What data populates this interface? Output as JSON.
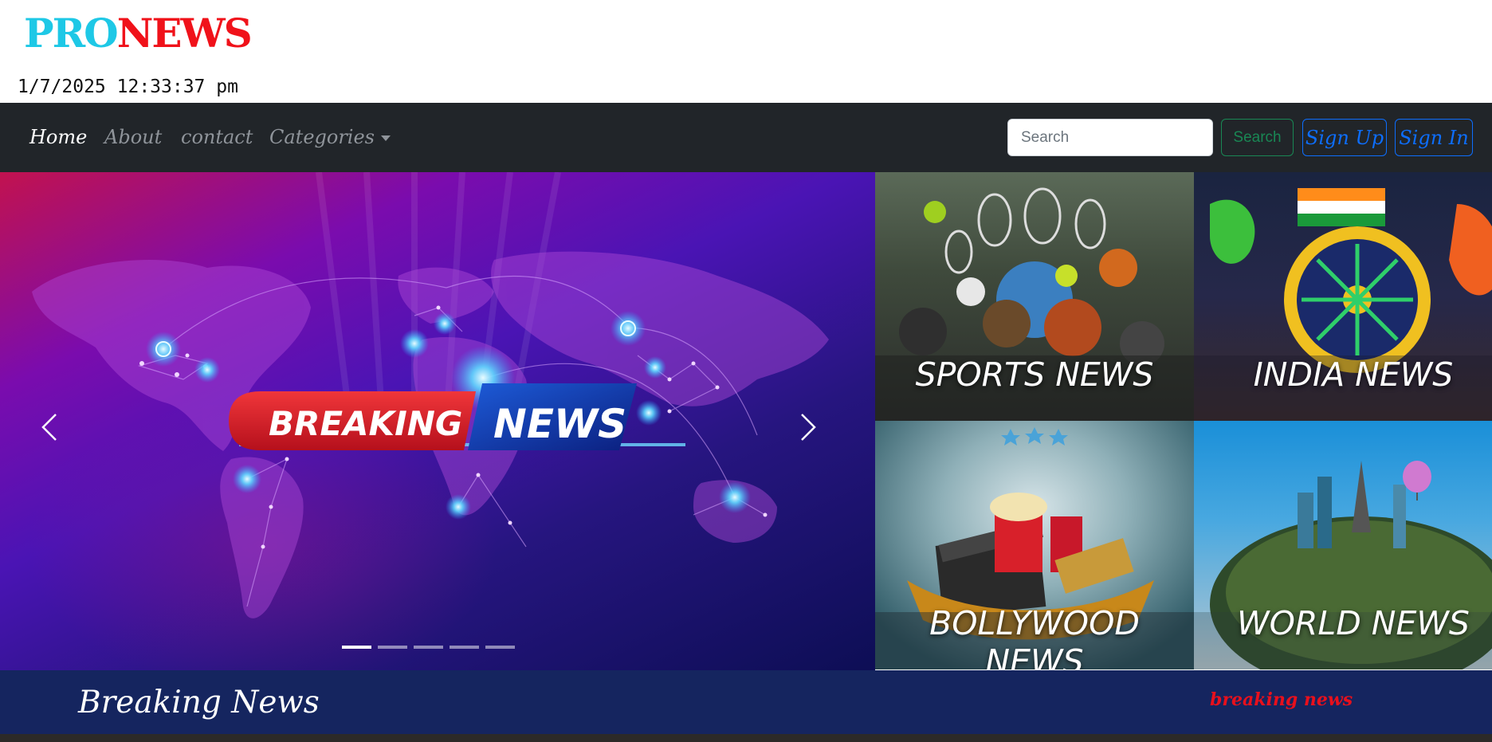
{
  "header": {
    "logo_part1": "PRO",
    "logo_part2": "NEWS",
    "datetime": "1/7/2025 12:33:37 pm"
  },
  "navbar": {
    "links": [
      {
        "label": "Home",
        "active": true
      },
      {
        "label": "About",
        "active": false
      },
      {
        "label": "contact",
        "active": false
      },
      {
        "label": "Categories",
        "active": false
      }
    ],
    "search_placeholder": "Search",
    "search_button": "Search",
    "signup_button": "Sign Up",
    "signin_button": "Sign In"
  },
  "carousel": {
    "banner_left": "BREAKING",
    "banner_right": "NEWS",
    "slide_count": 5,
    "active_slide": 1
  },
  "categories": [
    {
      "label": "SPORTS NEWS"
    },
    {
      "label": "INDIA NEWS"
    },
    {
      "label": "BOLLYWOOD NEWS"
    },
    {
      "label": "WORLD NEWS"
    }
  ],
  "breaking": {
    "title": "Breaking News",
    "ticker": "breaking news"
  },
  "colors": {
    "logo_pro": "#1ec8e6",
    "logo_news": "#f0121a",
    "navbar_bg": "#212529",
    "breaking_bar_bg": "#15255f",
    "ticker_text": "#e8101c",
    "search_button": "#198754",
    "auth_buttons": "#0d6efd"
  }
}
